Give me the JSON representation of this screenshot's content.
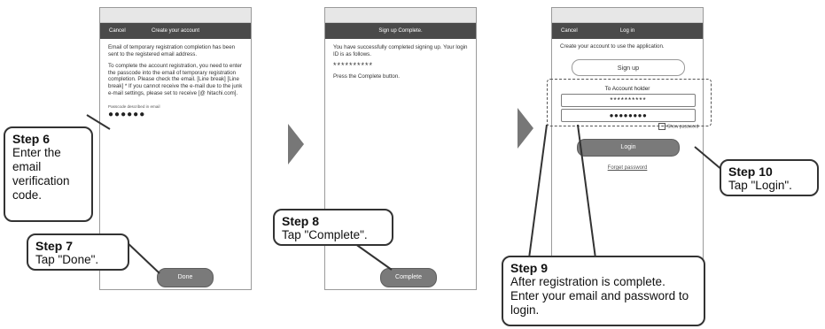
{
  "screen1": {
    "nav_left": "Cancel",
    "nav_title": "Create your account",
    "para1": "Email of temporary registration completion has been sent to the registered email address.",
    "para2": "To complete the account registration, you need to enter the passcode into the email of temporary registration completion. Please check the email. [Line break] [Line break] * If you cannot receive the e-mail due to the junk e-mail settings, please set to receive [@ hitachi.com].",
    "passcode_label": "Passcode described in email",
    "passcode_value": "●●●●●●",
    "done_label": "Done"
  },
  "screen2": {
    "nav_title": "Sign up Complete.",
    "text1": "You have successfully completed signing up. Your login ID is as follows.",
    "login_id": "**********",
    "text2": "Press the Complete button.",
    "complete_label": "Complete"
  },
  "screen3": {
    "nav_left": "Cancel",
    "nav_title": "Log in",
    "intro": "Create your account to use the application.",
    "signup_label": "Sign up",
    "account_label": "To Account holder",
    "email_value": "**********",
    "password_value": "●●●●●●●●",
    "show_password": "Show password",
    "login_label": "Login",
    "forget_label": "Forget password"
  },
  "steps": {
    "s6_title": "Step 6",
    "s6_text": "Enter the email verification code.",
    "s7_title": "Step 7",
    "s7_text": "Tap \"Done\".",
    "s8_title": "Step 8",
    "s8_text": "Tap \"Complete\".",
    "s9_title": "Step 9",
    "s9_text": "After registration is complete. Enter your email and password to login.",
    "s10_title": "Step 10",
    "s10_text": "Tap \"Login\"."
  },
  "colors": {
    "navbar": "#4a4a4a",
    "button": "#7a7a7a",
    "arrow": "#777777"
  }
}
